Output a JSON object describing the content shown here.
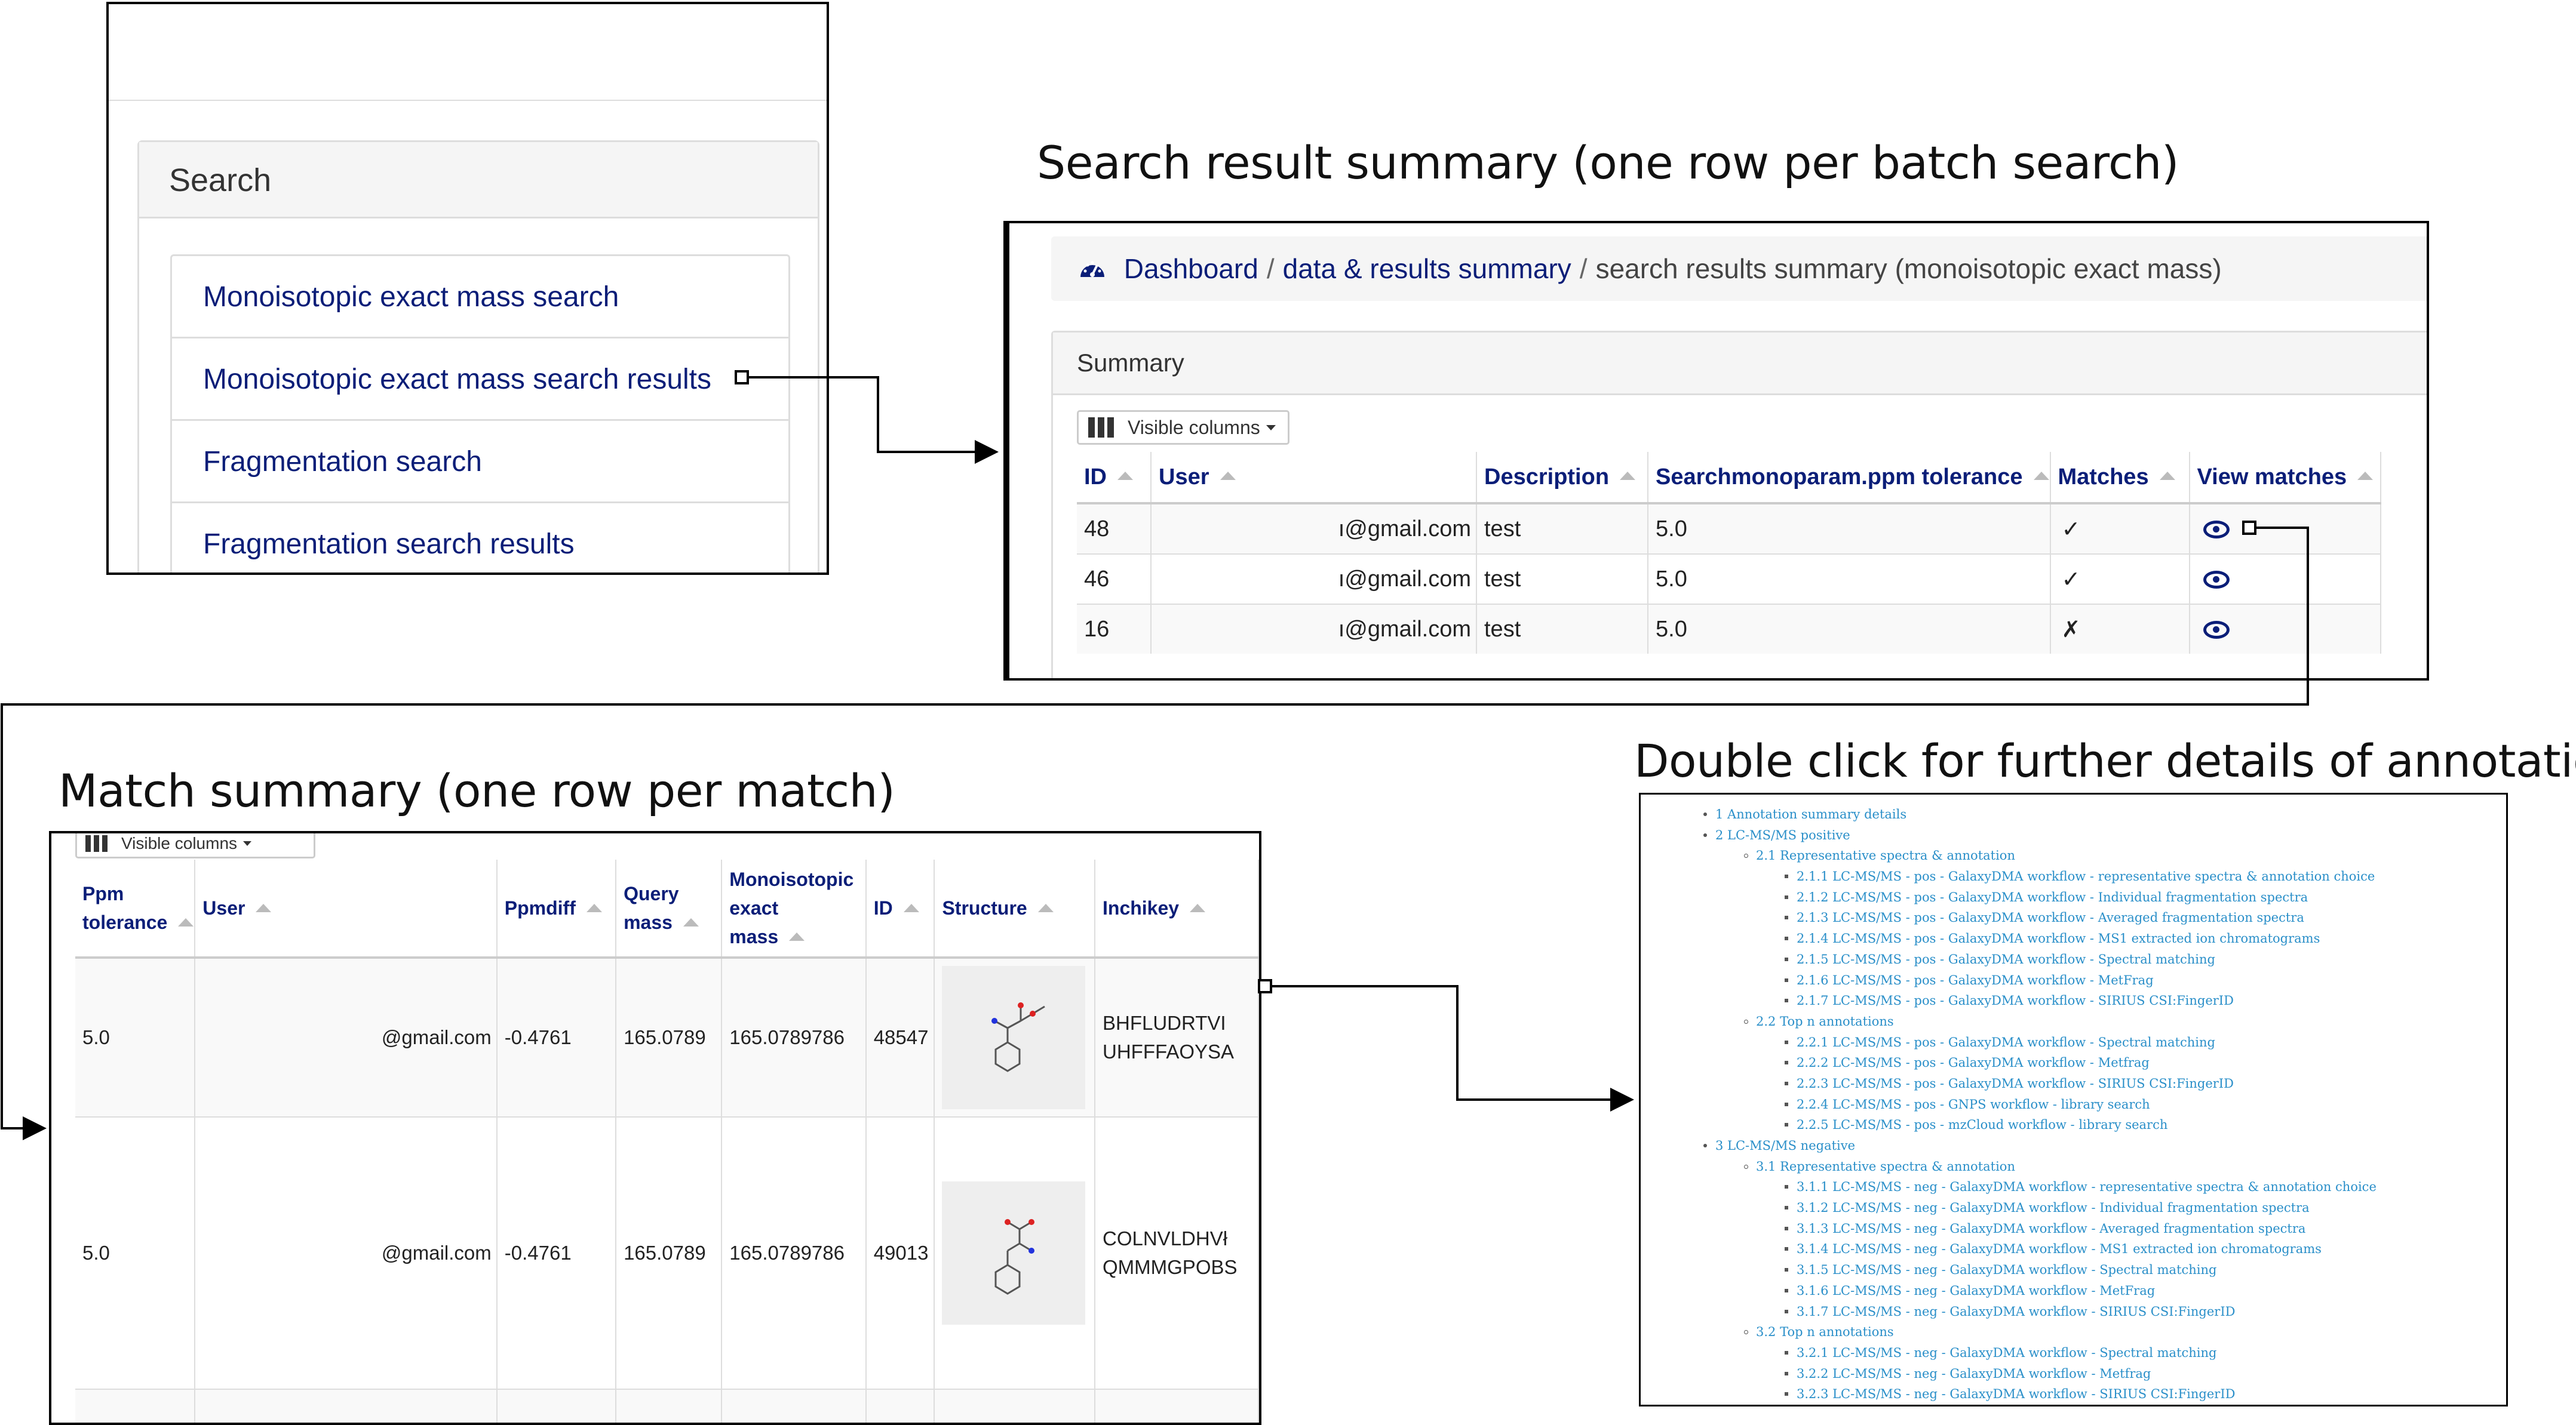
{
  "captions": {
    "search_result_summary": "Search result summary (one row per batch search)",
    "match_summary": "Match summary (one row per match)",
    "double_click": "Double click for further details of annotation"
  },
  "search_panel": {
    "title": "Search",
    "items": [
      "Monoisotopic exact mass search",
      "Monoisotopic exact mass search results",
      "Fragmentation search",
      "Fragmentation search results"
    ]
  },
  "breadcrumb": {
    "dashboard": "Dashboard",
    "sep": "/",
    "data_results": "data & results summary",
    "current": "search results summary (monoisotopic exact mass)"
  },
  "summary": {
    "title": "Summary",
    "visible_columns": "Visible columns",
    "columns": [
      "ID",
      "User",
      "Description",
      "Searchmonoparam.ppm tolerance",
      "Matches",
      "View matches"
    ],
    "rows": [
      {
        "id": "48",
        "user": "ı@gmail.com",
        "description": "test",
        "ppm": "5.0",
        "matches": "✓"
      },
      {
        "id": "46",
        "user": "ı@gmail.com",
        "description": "test",
        "ppm": "5.0",
        "matches": "✓"
      },
      {
        "id": "16",
        "user": "ı@gmail.com",
        "description": "test",
        "ppm": "5.0",
        "matches": "✗"
      }
    ]
  },
  "match_table": {
    "visible_columns": "Visible columns",
    "columns": [
      "Ppm tolerance",
      "User",
      "Ppmdiff",
      "Query mass",
      "Monoisotopic exact mass",
      "ID",
      "Structure",
      "Inchikey"
    ],
    "rows": [
      {
        "ppm": "5.0",
        "user": "@gmail.com",
        "ppmdiff": "-0.4761",
        "query_mass": "165.0789",
        "exact_mass": "165.0789786",
        "id": "48547",
        "inchikey_1": "BHFLUDRTVI",
        "inchikey_2": "UHFFFAOYSA"
      },
      {
        "ppm": "5.0",
        "user": "@gmail.com",
        "ppmdiff": "-0.4761",
        "query_mass": "165.0789",
        "exact_mass": "165.0789786",
        "id": "49013",
        "inchikey_1": "COLNVLDHVł",
        "inchikey_2": "QMMMGPOBS"
      }
    ]
  },
  "toc": [
    {
      "level": 1,
      "text": "1 Annotation summary details"
    },
    {
      "level": 1,
      "text": "2 LC-MS/MS positive"
    },
    {
      "level": 2,
      "text": "2.1 Representative spectra & annotation"
    },
    {
      "level": 3,
      "text": "2.1.1 LC-MS/MS - pos - GalaxyDMA workflow - representative spectra & annotation choice"
    },
    {
      "level": 3,
      "text": "2.1.2 LC-MS/MS - pos - GalaxyDMA workflow - Individual fragmentation spectra"
    },
    {
      "level": 3,
      "text": "2.1.3 LC-MS/MS - pos - GalaxyDMA workflow - Averaged fragmentation spectra"
    },
    {
      "level": 3,
      "text": "2.1.4 LC-MS/MS - pos - GalaxyDMA workflow - MS1 extracted ion chromatograms"
    },
    {
      "level": 3,
      "text": "2.1.5 LC-MS/MS - pos - GalaxyDMA workflow - Spectral matching"
    },
    {
      "level": 3,
      "text": "2.1.6 LC-MS/MS - pos - GalaxyDMA workflow - MetFrag"
    },
    {
      "level": 3,
      "text": "2.1.7 LC-MS/MS - pos - GalaxyDMA workflow - SIRIUS CSI:FingerID"
    },
    {
      "level": 2,
      "text": "2.2 Top n annotations"
    },
    {
      "level": 3,
      "text": "2.2.1 LC-MS/MS - pos - GalaxyDMA workflow - Spectral matching"
    },
    {
      "level": 3,
      "text": "2.2.2 LC-MS/MS - pos - GalaxyDMA workflow - Metfrag"
    },
    {
      "level": 3,
      "text": "2.2.3 LC-MS/MS - pos - GalaxyDMA workflow - SIRIUS CSI:FingerID"
    },
    {
      "level": 3,
      "text": "2.2.4 LC-MS/MS - pos - GNPS workflow - library search"
    },
    {
      "level": 3,
      "text": "2.2.5 LC-MS/MS - pos - mzCloud workflow - library search"
    },
    {
      "level": 1,
      "text": "3 LC-MS/MS negative"
    },
    {
      "level": 2,
      "text": "3.1 Representative spectra & annotation"
    },
    {
      "level": 3,
      "text": "3.1.1 LC-MS/MS - neg - GalaxyDMA workflow - representative spectra & annotation choice"
    },
    {
      "level": 3,
      "text": "3.1.2 LC-MS/MS - neg - GalaxyDMA workflow - Individual fragmentation spectra"
    },
    {
      "level": 3,
      "text": "3.1.3 LC-MS/MS - neg - GalaxyDMA workflow - Averaged fragmentation spectra"
    },
    {
      "level": 3,
      "text": "3.1.4 LC-MS/MS - neg - GalaxyDMA workflow - MS1 extracted ion chromatograms"
    },
    {
      "level": 3,
      "text": "3.1.5 LC-MS/MS - neg - GalaxyDMA workflow - Spectral matching"
    },
    {
      "level": 3,
      "text": "3.1.6 LC-MS/MS - neg - GalaxyDMA workflow - MetFrag"
    },
    {
      "level": 3,
      "text": "3.1.7 LC-MS/MS - neg - GalaxyDMA workflow - SIRIUS CSI:FingerID"
    },
    {
      "level": 2,
      "text": "3.2 Top n annotations"
    },
    {
      "level": 3,
      "text": "3.2.1 LC-MS/MS - neg - GalaxyDMA workflow - Spectral matching"
    },
    {
      "level": 3,
      "text": "3.2.2 LC-MS/MS - neg - GalaxyDMA workflow - Metfrag"
    },
    {
      "level": 3,
      "text": "3.2.3 LC-MS/MS - neg - GalaxyDMA workflow - SIRIUS CSI:FingerID"
    }
  ],
  "icons": {
    "dashboard": "dashboard-gauge-icon",
    "view": "eye-icon",
    "columns": "columns-icon",
    "sort": "sort-up-icon",
    "dropdown": "caret-down-icon"
  },
  "colors": {
    "link": "#0b1e78",
    "toc_link": "#2a8fc9",
    "panel_header": "#f5f5f5",
    "border": "#dddddd"
  }
}
